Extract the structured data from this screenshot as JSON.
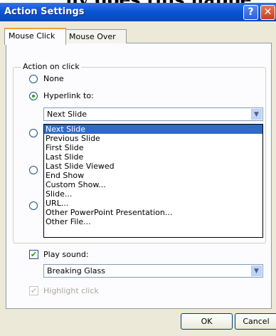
{
  "top_caption": "hy does this happe",
  "window": {
    "title": "Action Settings",
    "help_glyph": "?",
    "close_glyph": "✕"
  },
  "tabs": [
    {
      "label": "Mouse Click",
      "active": true
    },
    {
      "label": "Mouse Over",
      "active": false
    }
  ],
  "action_group": {
    "legend": "Action on click",
    "none_label": "None",
    "hyperlink_label": "Hyperlink to:",
    "selected_radio": "hyperlink",
    "hyperlink_value": "Next Slide",
    "dropdown_options": [
      "Next Slide",
      "Previous Slide",
      "First Slide",
      "Last Slide",
      "Last Slide Viewed",
      "End Show",
      "Custom Show...",
      "Slide...",
      "URL...",
      "Other PowerPoint Presentation...",
      "Other File..."
    ],
    "dropdown_selected": 0
  },
  "sound": {
    "play_sound_label": "Play sound:",
    "play_sound_checked": true,
    "sound_value": "Breaking Glass"
  },
  "highlight": {
    "label": "Highlight click",
    "checked": true,
    "disabled": true
  },
  "buttons": {
    "ok": "OK",
    "cancel": "Cancel"
  },
  "colors": {
    "title_bar": "#0a56d4",
    "selection": "#316ac5",
    "dialog_bg": "#ece9d8"
  },
  "icons": {
    "combo_arrow": "▼",
    "check": "✔"
  }
}
